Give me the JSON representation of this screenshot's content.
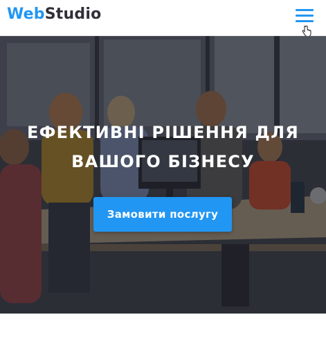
{
  "header": {
    "logo_part1": "Web",
    "logo_part2": "Studio",
    "menu_icon": "hamburger-menu-icon"
  },
  "hero": {
    "title_line1": "ЕФЕКТИВНІ РІШЕННЯ ДЛЯ",
    "title_line2": "ВАШОГО БІЗНЕСУ",
    "cta_label": "Замовити послугу"
  },
  "colors": {
    "accent": "#2196f3",
    "logo_dark": "#2f2f37"
  }
}
